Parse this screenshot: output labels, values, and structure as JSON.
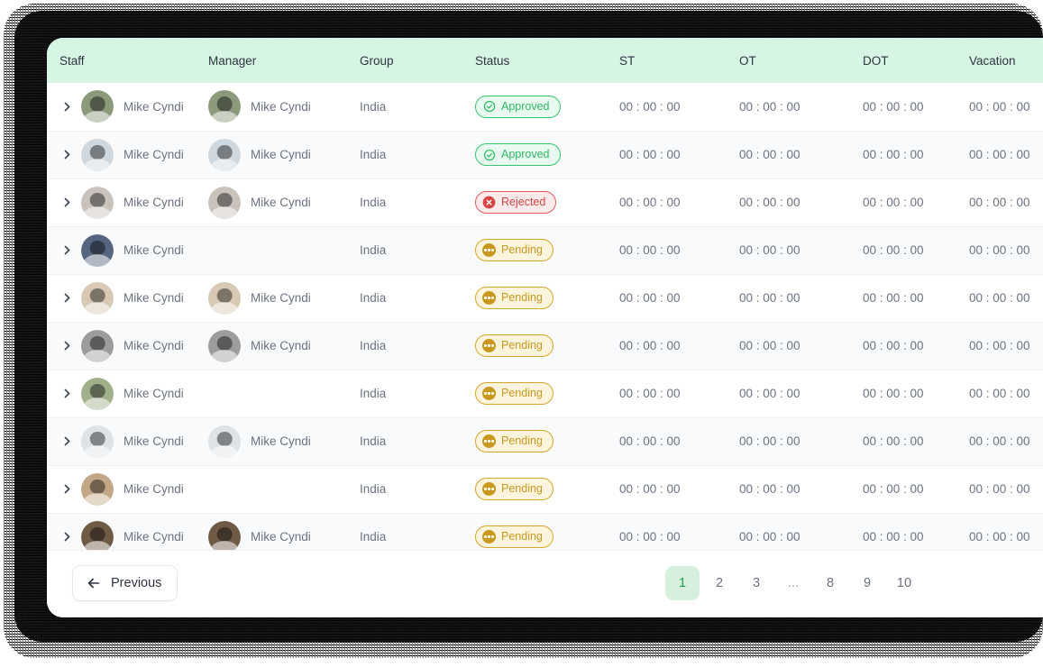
{
  "theme": {
    "header_bg": "#d6f5e3",
    "row_alt_bg": "#f9fafb",
    "approved_color": "#2fb765",
    "rejected_color": "#d64545",
    "pending_color": "#c8981f",
    "pager_active_bg": "#d6f0dd",
    "pager_active_text": "#1f9d4e"
  },
  "table": {
    "columns": [
      {
        "key": "staff",
        "label": "Staff"
      },
      {
        "key": "manager",
        "label": "Manager"
      },
      {
        "key": "group",
        "label": "Group"
      },
      {
        "key": "status",
        "label": "Status"
      },
      {
        "key": "st",
        "label": "ST"
      },
      {
        "key": "ot",
        "label": "OT"
      },
      {
        "key": "dot",
        "label": "DOT"
      },
      {
        "key": "vacation",
        "label": "Vacation"
      }
    ],
    "expand_icon": "chevron-right-icon",
    "rows": [
      {
        "staff": "Mike Cyndi",
        "manager": "Mike Cyndi",
        "group": "India",
        "status": "Approved",
        "status_icon": "check-circle-icon",
        "st": "00 : 00 : 00",
        "ot": "00 : 00 : 00",
        "dot": "00 : 00 : 00",
        "vacation": "00 : 00 : 00",
        "avatar_staff": "#8a9a7b",
        "avatar_manager": "#8a9a7b",
        "has_manager": true
      },
      {
        "staff": "Mike Cyndi",
        "manager": "Mike Cyndi",
        "group": "India",
        "status": "Approved",
        "status_icon": "check-circle-icon",
        "st": "00 : 00 : 00",
        "ot": "00 : 00 : 00",
        "dot": "00 : 00 : 00",
        "vacation": "00 : 00 : 00",
        "avatar_staff": "#cfd8de",
        "avatar_manager": "#cfd8de",
        "has_manager": true
      },
      {
        "staff": "Mike Cyndi",
        "manager": "Mike Cyndi",
        "group": "India",
        "status": "Rejected",
        "status_icon": "x-circle-icon",
        "st": "00 : 00 : 00",
        "ot": "00 : 00 : 00",
        "dot": "00 : 00 : 00",
        "vacation": "00 : 00 : 00",
        "avatar_staff": "#c9c3bb",
        "avatar_manager": "#c9c3bb",
        "has_manager": true
      },
      {
        "staff": "Mike Cyndi",
        "manager": "",
        "group": "India",
        "status": "Pending",
        "status_icon": "ellipsis-circle-icon",
        "st": "00 : 00 : 00",
        "ot": "00 : 00 : 00",
        "dot": "00 : 00 : 00",
        "vacation": "00 : 00 : 00",
        "avatar_staff": "#55657f",
        "avatar_manager": "",
        "has_manager": false
      },
      {
        "staff": "Mike Cyndi",
        "manager": "Mike Cyndi",
        "group": "India",
        "status": "Pending",
        "status_icon": "ellipsis-circle-icon",
        "st": "00 : 00 : 00",
        "ot": "00 : 00 : 00",
        "dot": "00 : 00 : 00",
        "vacation": "00 : 00 : 00",
        "avatar_staff": "#d8c9b4",
        "avatar_manager": "#d8c9b4",
        "has_manager": true
      },
      {
        "staff": "Mike Cyndi",
        "manager": "Mike Cyndi",
        "group": "India",
        "status": "Pending",
        "status_icon": "ellipsis-circle-icon",
        "st": "00 : 00 : 00",
        "ot": "00 : 00 : 00",
        "dot": "00 : 00 : 00",
        "vacation": "00 : 00 : 00",
        "avatar_staff": "#9c9c9c",
        "avatar_manager": "#9c9c9c",
        "has_manager": true
      },
      {
        "staff": "Mike Cyndi",
        "manager": "",
        "group": "India",
        "status": "Pending",
        "status_icon": "ellipsis-circle-icon",
        "st": "00 : 00 : 00",
        "ot": "00 : 00 : 00",
        "dot": "00 : 00 : 00",
        "vacation": "00 : 00 : 00",
        "avatar_staff": "#9fb08a",
        "avatar_manager": "",
        "has_manager": false
      },
      {
        "staff": "Mike Cyndi",
        "manager": "Mike Cyndi",
        "group": "India",
        "status": "Pending",
        "status_icon": "ellipsis-circle-icon",
        "st": "00 : 00 : 00",
        "ot": "00 : 00 : 00",
        "dot": "00 : 00 : 00",
        "vacation": "00 : 00 : 00",
        "avatar_staff": "#dfe3e7",
        "avatar_manager": "#dfe3e7",
        "has_manager": true
      },
      {
        "staff": "Mike Cyndi",
        "manager": "",
        "group": "India",
        "status": "Pending",
        "status_icon": "ellipsis-circle-icon",
        "st": "00 : 00 : 00",
        "ot": "00 : 00 : 00",
        "dot": "00 : 00 : 00",
        "vacation": "00 : 00 : 00",
        "avatar_staff": "#c3a888",
        "avatar_manager": "",
        "has_manager": false
      },
      {
        "staff": "Mike Cyndi",
        "manager": "Mike Cyndi",
        "group": "India",
        "status": "Pending",
        "status_icon": "ellipsis-circle-icon",
        "st": "00 : 00 : 00",
        "ot": "00 : 00 : 00",
        "dot": "00 : 00 : 00",
        "vacation": "00 : 00 : 00",
        "avatar_staff": "#6f5a46",
        "avatar_manager": "#6f5a46",
        "has_manager": true
      }
    ]
  },
  "footer": {
    "previous_label": "Previous",
    "previous_icon": "arrow-left-icon",
    "pages": [
      {
        "label": "1",
        "active": true,
        "gap": false
      },
      {
        "label": "2",
        "active": false,
        "gap": false
      },
      {
        "label": "3",
        "active": false,
        "gap": false
      },
      {
        "label": "...",
        "active": false,
        "gap": true
      },
      {
        "label": "8",
        "active": false,
        "gap": false
      },
      {
        "label": "9",
        "active": false,
        "gap": false
      },
      {
        "label": "10",
        "active": false,
        "gap": false
      }
    ]
  }
}
